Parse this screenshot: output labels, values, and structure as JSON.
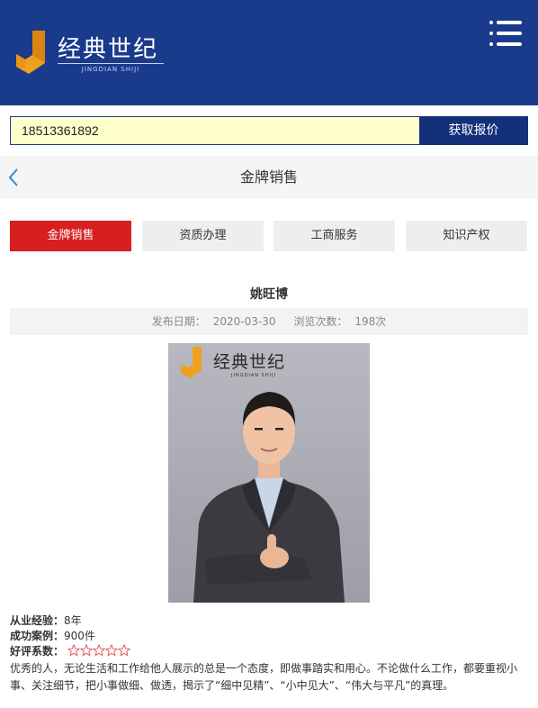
{
  "header": {
    "logo_text": "经典世纪",
    "logo_subtext": "JINGDIAN SHIJI",
    "brand_color": "#1a3a8c"
  },
  "quote": {
    "phone_value": "18513361892",
    "button_label": "获取报价"
  },
  "nav": {
    "title": "金牌销售"
  },
  "tabs": [
    {
      "label": "金牌销售",
      "active": true
    },
    {
      "label": "资质办理",
      "active": false
    },
    {
      "label": "工商服务",
      "active": false
    },
    {
      "label": "知识产权",
      "active": false
    }
  ],
  "article": {
    "name": "姚旺博",
    "publish_label": "发布日期：",
    "publish_date": "2020-03-30",
    "views_label": "浏览次数：",
    "views_count": "198次"
  },
  "photo": {
    "logo_text": "经典世纪",
    "logo_subtext": "JINGDIAN SHIJI"
  },
  "details": {
    "experience_label": "从业经验：",
    "experience_value": "8年",
    "cases_label": "成功案例：",
    "cases_value": "900件",
    "rating_label": "好评系数：",
    "rating_stars": 0,
    "rating_max": 5,
    "description": "优秀的人，无论生活和工作给他人展示的总是一个态度，即做事踏实和用心。不论做什么工作，都要重视小事、关注细节，把小事做细、做透，揭示了“细中见精”、“小中见大”、“伟大与平凡”的真理。"
  },
  "colors": {
    "active_tab": "#d81e1e",
    "quote_button": "#14307a",
    "input_bg": "#ffffcc",
    "star_outline": "#e05a5a"
  }
}
